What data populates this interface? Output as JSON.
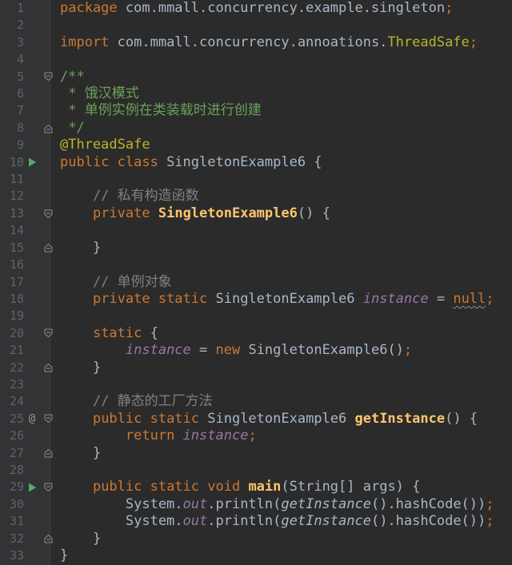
{
  "palette": {
    "editor_bg": "#2B2B2B",
    "gutter_bg": "#313335",
    "gutter_line": "#3D4042",
    "line_number": "#606366",
    "kw": "#CC7832",
    "def": "#A9B7C6",
    "semi": "#CC7832",
    "doc": "#6BA25A",
    "cmt": "#808080",
    "ann": "#BBB529",
    "mdecl": "#FFC66D",
    "field": "#9876AA",
    "run_icon": "#59A869",
    "fold_icon": "#8C8C8C",
    "at_icon": "#9A9A9A"
  },
  "gutter_icons": {
    "at_glyph": "@"
  },
  "editor": {
    "language": "java",
    "lines": [
      {
        "n": "1",
        "g": [],
        "t": [
          [
            "kw",
            "package"
          ],
          [
            "def",
            " com.mmall.concurrency.example.singleton"
          ],
          [
            "semi",
            ";"
          ]
        ]
      },
      {
        "n": "2",
        "g": [],
        "t": []
      },
      {
        "n": "3",
        "g": [],
        "t": [
          [
            "kw",
            "import"
          ],
          [
            "def",
            " com.mmall.concurrency.annoations."
          ],
          [
            "ann",
            "ThreadSafe"
          ],
          [
            "semi",
            ";"
          ]
        ]
      },
      {
        "n": "4",
        "g": [],
        "t": []
      },
      {
        "n": "5",
        "g": [
          "fold_start"
        ],
        "t": [
          [
            "doc",
            "/**"
          ]
        ]
      },
      {
        "n": "6",
        "g": [],
        "t": [
          [
            "doc",
            " * 饿汉模式"
          ]
        ]
      },
      {
        "n": "7",
        "g": [],
        "t": [
          [
            "doc",
            " * 单例实例在类装载时进行创建"
          ]
        ]
      },
      {
        "n": "8",
        "g": [
          "fold_end"
        ],
        "t": [
          [
            "doc",
            " */"
          ]
        ]
      },
      {
        "n": "9",
        "g": [],
        "t": [
          [
            "ann",
            "@ThreadSafe"
          ]
        ]
      },
      {
        "n": "10",
        "g": [
          "run"
        ],
        "t": [
          [
            "kw",
            "public class"
          ],
          [
            "def",
            " SingletonExample6 {"
          ]
        ]
      },
      {
        "n": "11",
        "g": [],
        "t": []
      },
      {
        "n": "12",
        "g": [],
        "t": [
          [
            "cmt",
            "    // 私有构造函数"
          ]
        ]
      },
      {
        "n": "13",
        "g": [
          "fold_start"
        ],
        "t": [
          [
            "def",
            "    "
          ],
          [
            "kw",
            "private"
          ],
          [
            "def",
            " "
          ],
          [
            "mdecl",
            "SingletonExample6"
          ],
          [
            "def",
            "() {"
          ]
        ]
      },
      {
        "n": "14",
        "g": [],
        "t": []
      },
      {
        "n": "15",
        "g": [
          "fold_end"
        ],
        "t": [
          [
            "def",
            "    }"
          ]
        ]
      },
      {
        "n": "16",
        "g": [],
        "t": []
      },
      {
        "n": "17",
        "g": [],
        "t": [
          [
            "cmt",
            "    // 单例对象"
          ]
        ]
      },
      {
        "n": "18",
        "g": [],
        "t": [
          [
            "def",
            "    "
          ],
          [
            "kw",
            "private static"
          ],
          [
            "def",
            " SingletonExample6 "
          ],
          [
            "field",
            "instance"
          ],
          [
            "def",
            " = "
          ],
          [
            "kwwavy",
            "null"
          ],
          [
            "semi",
            ";"
          ]
        ]
      },
      {
        "n": "19",
        "g": [],
        "t": []
      },
      {
        "n": "20",
        "g": [
          "fold_start"
        ],
        "t": [
          [
            "def",
            "    "
          ],
          [
            "kw",
            "static"
          ],
          [
            "def",
            " {"
          ]
        ]
      },
      {
        "n": "21",
        "g": [],
        "t": [
          [
            "def",
            "        "
          ],
          [
            "field",
            "instance"
          ],
          [
            "def",
            " = "
          ],
          [
            "kw",
            "new"
          ],
          [
            "def",
            " SingletonExample6()"
          ],
          [
            "semi",
            ";"
          ]
        ]
      },
      {
        "n": "22",
        "g": [
          "fold_end"
        ],
        "t": [
          [
            "def",
            "    }"
          ]
        ]
      },
      {
        "n": "23",
        "g": [],
        "t": []
      },
      {
        "n": "24",
        "g": [],
        "t": [
          [
            "cmt",
            "    // 静态的工厂方法"
          ]
        ]
      },
      {
        "n": "25",
        "g": [
          "at",
          "fold_start"
        ],
        "t": [
          [
            "def",
            "    "
          ],
          [
            "kw",
            "public static"
          ],
          [
            "def",
            " SingletonExample6 "
          ],
          [
            "mdecl",
            "getInstance"
          ],
          [
            "def",
            "() {"
          ]
        ]
      },
      {
        "n": "26",
        "g": [],
        "t": [
          [
            "def",
            "        "
          ],
          [
            "kw",
            "return"
          ],
          [
            "def",
            " "
          ],
          [
            "field",
            "instance"
          ],
          [
            "semi",
            ";"
          ]
        ]
      },
      {
        "n": "27",
        "g": [
          "fold_end"
        ],
        "t": [
          [
            "def",
            "    }"
          ]
        ]
      },
      {
        "n": "28",
        "g": [],
        "t": []
      },
      {
        "n": "29",
        "g": [
          "run",
          "fold_start"
        ],
        "t": [
          [
            "def",
            "    "
          ],
          [
            "kw",
            "public static void"
          ],
          [
            "def",
            " "
          ],
          [
            "mdecl",
            "main"
          ],
          [
            "def",
            "(String[] args) {"
          ]
        ]
      },
      {
        "n": "30",
        "g": [],
        "t": [
          [
            "def",
            "        System."
          ],
          [
            "field",
            "out"
          ],
          [
            "def",
            ".println("
          ],
          [
            "smcall",
            "getInstance"
          ],
          [
            "def",
            "().hashCode())"
          ],
          [
            "semi",
            ";"
          ]
        ]
      },
      {
        "n": "31",
        "g": [],
        "t": [
          [
            "def",
            "        System."
          ],
          [
            "field",
            "out"
          ],
          [
            "def",
            ".println("
          ],
          [
            "smcall",
            "getInstance"
          ],
          [
            "def",
            "().hashCode())"
          ],
          [
            "semi",
            ";"
          ]
        ]
      },
      {
        "n": "32",
        "g": [
          "fold_end"
        ],
        "t": [
          [
            "def",
            "    }"
          ]
        ]
      },
      {
        "n": "33",
        "g": [],
        "t": [
          [
            "def",
            "}"
          ]
        ]
      }
    ]
  }
}
